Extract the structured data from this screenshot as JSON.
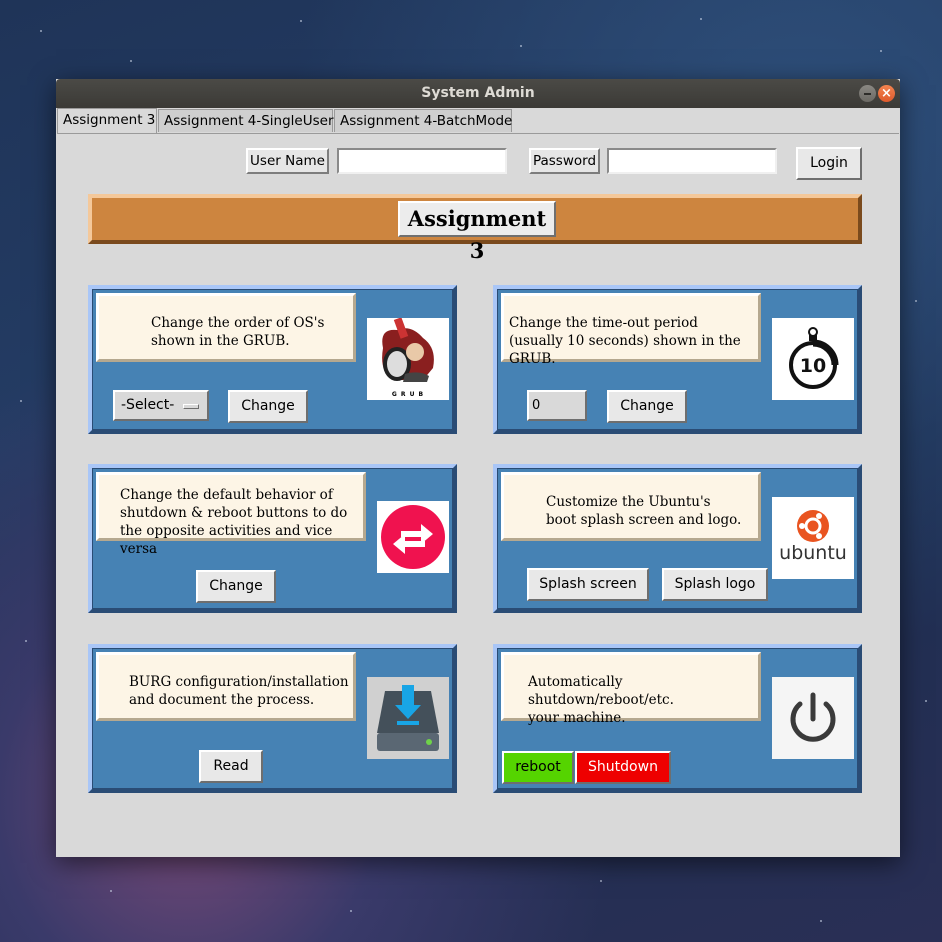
{
  "window": {
    "title": "System Admin",
    "close_glyph": "×"
  },
  "tabs": [
    "Assignment 3",
    "Assignment 4-SingleUser",
    "Assignment 4-BatchMode"
  ],
  "login": {
    "username_label": "User Name",
    "username_value": "",
    "password_label": "Password",
    "password_value": "",
    "login_button": "Login"
  },
  "banner": {
    "title": "Assignment 3"
  },
  "panels": {
    "grub_order": {
      "text": "Change the order of OS's\nshown in the GRUB.",
      "select_value": "-Select-",
      "button": "Change",
      "icon": "grub-icon",
      "icon_caption": "G R U B"
    },
    "grub_timeout": {
      "text": "Change the time-out period\n(usually 10 seconds) shown in the GRUB.",
      "input_value": "0",
      "button": "Change",
      "icon": "stopwatch-icon",
      "icon_number": "10"
    },
    "shutdown_behavior": {
      "text": "Change the default behavior of\nshutdown & reboot buttons to do\nthe opposite activities and vice versa",
      "button": "Change",
      "icon": "swap-arrows-icon"
    },
    "splash": {
      "text": "Customize the Ubuntu's\nboot splash screen and logo.",
      "button_screen": "Splash screen",
      "button_logo": "Splash logo",
      "icon": "ubuntu-logo-icon",
      "icon_caption": "ubuntu"
    },
    "burg": {
      "text": "BURG configuration/installation\nand document the process.",
      "button": "Read",
      "icon": "download-drive-icon"
    },
    "auto_shutdown": {
      "text": "Automatically shutdown/reboot/etc.\nyour machine.",
      "button_reboot": "reboot",
      "button_shutdown": "Shutdown",
      "icon": "power-icon"
    }
  },
  "colors": {
    "panel_bg": "#4682b4",
    "banner_bg": "#cd853f",
    "note_bg": "#fdf5e6",
    "reboot_bg": "#55d400",
    "shutdown_bg": "#ee0000"
  }
}
